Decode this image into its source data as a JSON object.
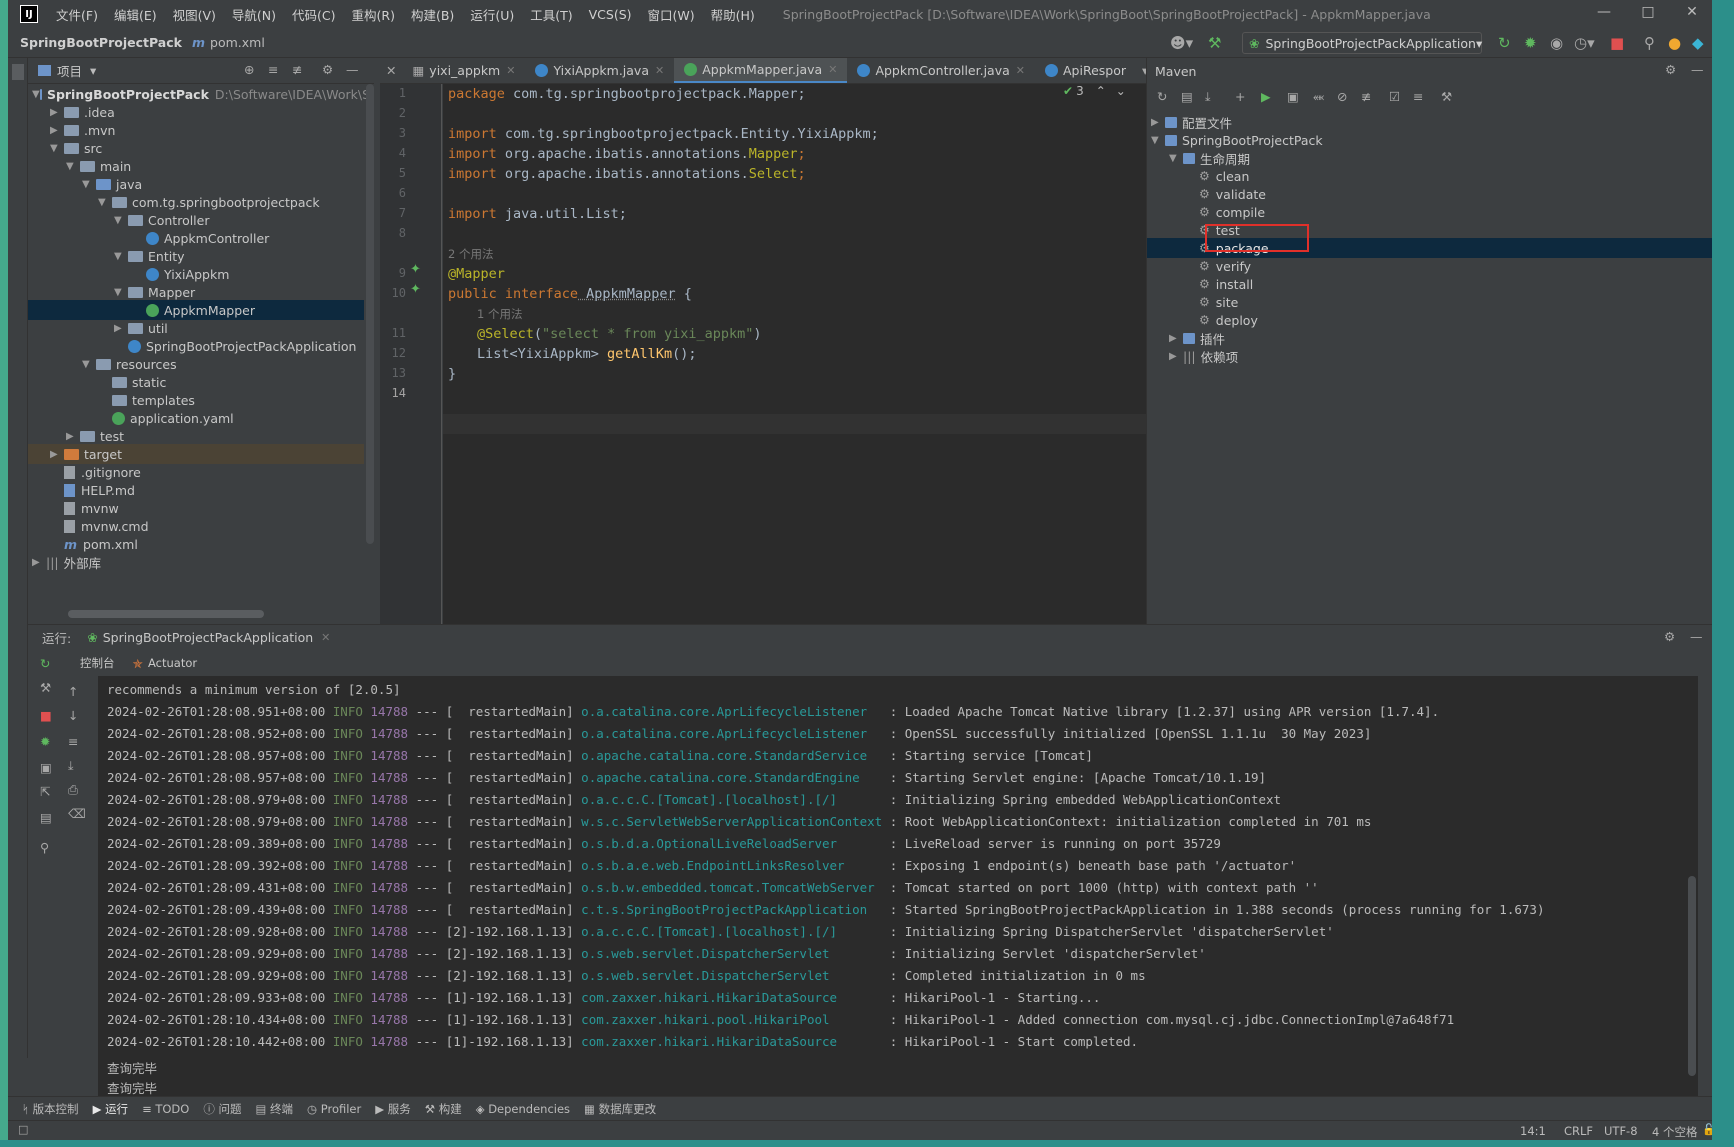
{
  "window": {
    "menu": [
      "文件(F)",
      "编辑(E)",
      "视图(V)",
      "导航(N)",
      "代码(C)",
      "重构(R)",
      "构建(B)",
      "运行(U)",
      "工具(T)",
      "VCS(S)",
      "窗口(W)",
      "帮助(H)"
    ],
    "title": "SpringBootProjectPack [D:\\Software\\IDEA\\Work\\SpringBoot\\SpringBootProjectPack] - AppkmMapper.java"
  },
  "navbar": {
    "project": "SpringBootProjectPack",
    "file": "pom.xml",
    "run_config": "SpringBootProjectPackApplication"
  },
  "project_panel": {
    "title": "项目",
    "root_name": "SpringBootProjectPack",
    "root_path": "D:\\Software\\IDEA\\Work\\Sp",
    "nodes": [
      ".idea",
      ".mvn",
      "src",
      "main",
      "java",
      "com.tg.springbootprojectpack",
      "Controller",
      "AppkmController",
      "Entity",
      "YixiAppkm",
      "Mapper",
      "AppkmMapper",
      "util",
      "SpringBootProjectPackApplication",
      "resources",
      "static",
      "templates",
      "application.yaml",
      "test",
      "target",
      ".gitignore",
      "HELP.md",
      "mvnw",
      "mvnw.cmd",
      "pom.xml",
      "外部库"
    ]
  },
  "editor": {
    "tabs": [
      "yixi_appkm",
      "YixiAppkm.java",
      "AppkmMapper.java",
      "AppkmController.java",
      "ApiRespor"
    ],
    "warning_count": "3",
    "line_numbers": [
      "1",
      "2",
      "3",
      "4",
      "5",
      "6",
      "7",
      "8",
      "9",
      "10",
      "11",
      "12",
      "13",
      "14"
    ],
    "usage_hint_1": "2 个用法",
    "usage_hint_2": "1 个用法",
    "l1_kw": "package",
    "l1_rest": " com.tg.springbootprojectpack.Mapper;",
    "l3_kw": "import",
    "l3_rest": " com.tg.springbootprojectpack.Entity.YixiAppkm;",
    "l4_kw": "import",
    "l4_a": " org.apache.ibatis.annotations.",
    "l4_b": "Mapper",
    "l4_c": ";",
    "l5_kw": "import",
    "l5_a": " org.apache.ibatis.annotations.",
    "l5_b": "Select",
    "l5_c": ";",
    "l7_kw": "import",
    "l7_rest": " java.util.List;",
    "l9": "@Mapper",
    "l10_kw": "public interface",
    "l10_name": " AppkmMapper",
    "l10_rest": " {",
    "l11_ann": "@Select",
    "l11_a": "(",
    "l11_str": "\"select * from yixi_appkm\"",
    "l11_b": ")",
    "l12_a": "List<YixiAppkm> ",
    "l12_fn": "getAllKm",
    "l12_b": "();",
    "l13": "}"
  },
  "maven": {
    "title": "Maven",
    "config_files": "配置文件",
    "project": "SpringBootProjectPack",
    "lifecycle": "生命周期",
    "goals": [
      "clean",
      "validate",
      "compile",
      "test",
      "package",
      "verify",
      "install",
      "site",
      "deploy"
    ],
    "plugins": "插件",
    "dependencies": "依赖项",
    "highlight_color": "#e0302a"
  },
  "run_panel": {
    "label": "运行:",
    "config": "SpringBootProjectPackApplication",
    "tab_console": "控制台",
    "tab_actuator": "Actuator",
    "first_line": "recommends a minimum version of [2.0.5]",
    "logs": [
      [
        "2024-02-26T01:28:08.951+08:00",
        "INFO",
        "14788",
        "--- [  restartedMain]",
        "o.a.catalina.core.AprLifecycleListener  ",
        ": Loaded Apache Tomcat Native library [1.2.37] using APR version [1.7.4]."
      ],
      [
        "2024-02-26T01:28:08.952+08:00",
        "INFO",
        "14788",
        "--- [  restartedMain]",
        "o.a.catalina.core.AprLifecycleListener  ",
        ": OpenSSL successfully initialized [OpenSSL 1.1.1u  30 May 2023]"
      ],
      [
        "2024-02-26T01:28:08.957+08:00",
        "INFO",
        "14788",
        "--- [  restartedMain]",
        "o.apache.catalina.core.StandardService  ",
        ": Starting service [Tomcat]"
      ],
      [
        "2024-02-26T01:28:08.957+08:00",
        "INFO",
        "14788",
        "--- [  restartedMain]",
        "o.apache.catalina.core.StandardEngine   ",
        ": Starting Servlet engine: [Apache Tomcat/10.1.19]"
      ],
      [
        "2024-02-26T01:28:08.979+08:00",
        "INFO",
        "14788",
        "--- [  restartedMain]",
        "o.a.c.c.C.[Tomcat].[localhost].[/]      ",
        ": Initializing Spring embedded WebApplicationContext"
      ],
      [
        "2024-02-26T01:28:08.979+08:00",
        "INFO",
        "14788",
        "--- [  restartedMain]",
        "w.s.c.ServletWebServerApplicationContext",
        ": Root WebApplicationContext: initialization completed in 701 ms"
      ],
      [
        "2024-02-26T01:28:09.389+08:00",
        "INFO",
        "14788",
        "--- [  restartedMain]",
        "o.s.b.d.a.OptionalLiveReloadServer      ",
        ": LiveReload server is running on port 35729"
      ],
      [
        "2024-02-26T01:28:09.392+08:00",
        "INFO",
        "14788",
        "--- [  restartedMain]",
        "o.s.b.a.e.web.EndpointLinksResolver     ",
        ": Exposing 1 endpoint(s) beneath base path '/actuator'"
      ],
      [
        "2024-02-26T01:28:09.431+08:00",
        "INFO",
        "14788",
        "--- [  restartedMain]",
        "o.s.b.w.embedded.tomcat.TomcatWebServer ",
        ": Tomcat started on port 1000 (http) with context path ''"
      ],
      [
        "2024-02-26T01:28:09.439+08:00",
        "INFO",
        "14788",
        "--- [  restartedMain]",
        "c.t.s.SpringBootProjectPackApplication  ",
        ": Started SpringBootProjectPackApplication in 1.388 seconds (process running for 1.673)"
      ],
      [
        "2024-02-26T01:28:09.928+08:00",
        "INFO",
        "14788",
        "--- [2]-192.168.1.13]",
        "o.a.c.c.C.[Tomcat].[localhost].[/]      ",
        ": Initializing Spring DispatcherServlet 'dispatcherServlet'"
      ],
      [
        "2024-02-26T01:28:09.929+08:00",
        "INFO",
        "14788",
        "--- [2]-192.168.1.13]",
        "o.s.web.servlet.DispatcherServlet       ",
        ": Initializing Servlet 'dispatcherServlet'"
      ],
      [
        "2024-02-26T01:28:09.929+08:00",
        "INFO",
        "14788",
        "--- [2]-192.168.1.13]",
        "o.s.web.servlet.DispatcherServlet       ",
        ": Completed initialization in 0 ms"
      ],
      [
        "2024-02-26T01:28:09.933+08:00",
        "INFO",
        "14788",
        "--- [1]-192.168.1.13]",
        "com.zaxxer.hikari.HikariDataSource      ",
        ": HikariPool-1 - Starting..."
      ],
      [
        "2024-02-26T01:28:10.434+08:00",
        "INFO",
        "14788",
        "--- [1]-192.168.1.13]",
        "com.zaxxer.hikari.pool.HikariPool       ",
        ": HikariPool-1 - Added connection com.mysql.cj.jdbc.ConnectionImpl@7a648f71"
      ],
      [
        "2024-02-26T01:28:10.442+08:00",
        "INFO",
        "14788",
        "--- [1]-192.168.1.13]",
        "com.zaxxer.hikari.HikariDataSource      ",
        ": HikariPool-1 - Start completed."
      ]
    ],
    "tail": [
      "查询完毕",
      "查询完毕"
    ]
  },
  "statusbar": {
    "items": [
      "版本控制",
      "运行",
      "TODO",
      "问题",
      "终端",
      "Profiler",
      "服务",
      "构建",
      "Dependencies",
      "数据库更改"
    ],
    "position": "14:1",
    "line_sep": "CRLF",
    "encoding": "UTF-8",
    "indent": "4 个空格"
  }
}
